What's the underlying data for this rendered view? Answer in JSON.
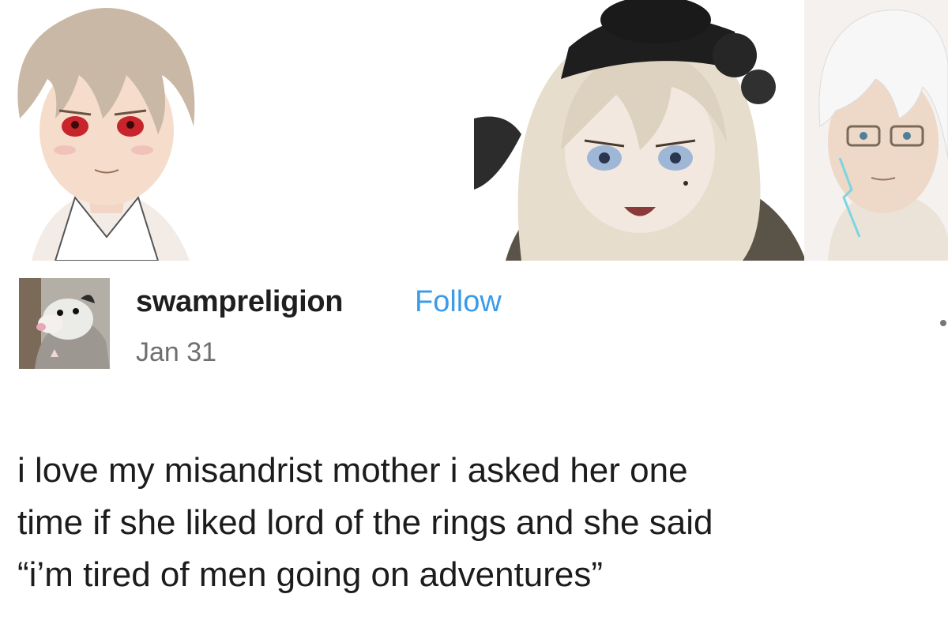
{
  "post": {
    "username": "swampreligion",
    "follow_label": "Follow",
    "date": "Jan 31",
    "body_lines": [
      "i love my misandrist mother i asked her one",
      "time if she liked lord of the rings and she said",
      "“i’m tired of men going on adventures”"
    ]
  },
  "images": {
    "left": "anime-boy-red-eyes-illustration",
    "center": "anime-girl-black-hat-illustration",
    "right": "anime-man-glasses-illustration",
    "avatar": "opossum-avatar"
  },
  "colors": {
    "follow": "#3a9bea",
    "username": "#1f1f1f",
    "date": "#6f6f6f",
    "body": "#1c1c1c"
  }
}
